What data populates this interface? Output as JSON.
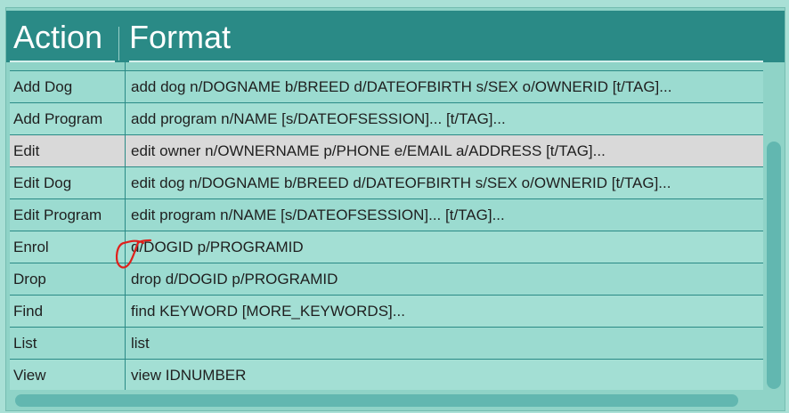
{
  "header": {
    "action_label": "Action",
    "format_label": "Format"
  },
  "rows": [
    {
      "action": "Add Dog",
      "format": "add dog n/DOGNAME b/BREED d/DATEOFBIRTH s/SEX o/OWNERID [t/TAG]..."
    },
    {
      "action": "Add Program",
      "format": "add program n/NAME [s/DATEOFSESSION]... [t/TAG]..."
    },
    {
      "action": "Edit",
      "format": "edit owner n/OWNERNAME p/PHONE e/EMAIL a/ADDRESS [t/TAG]...",
      "selected": true
    },
    {
      "action": "Edit Dog",
      "format": "edit dog n/DOGNAME b/BREED d/DATEOFBIRTH s/SEX o/OWNERID [t/TAG]..."
    },
    {
      "action": "Edit Program",
      "format": "edit program n/NAME [s/DATEOFSESSION]... [t/TAG]..."
    },
    {
      "action": "Enrol",
      "format": "d/DOGID p/PROGRAMID"
    },
    {
      "action": "Drop",
      "format": "drop d/DOGID p/PROGRAMID"
    },
    {
      "action": "Find",
      "format": "find KEYWORD [MORE_KEYWORDS]..."
    },
    {
      "action": "List",
      "format": "list"
    },
    {
      "action": "View",
      "format": "view IDNUMBER"
    }
  ],
  "annotation": {
    "color": "#e0201b"
  },
  "colors": {
    "header_bg": "#2a8a86",
    "row_bg": "#9bdbd0",
    "selected_bg": "#d9d9d9",
    "scrollbar": "#62b7b0"
  }
}
